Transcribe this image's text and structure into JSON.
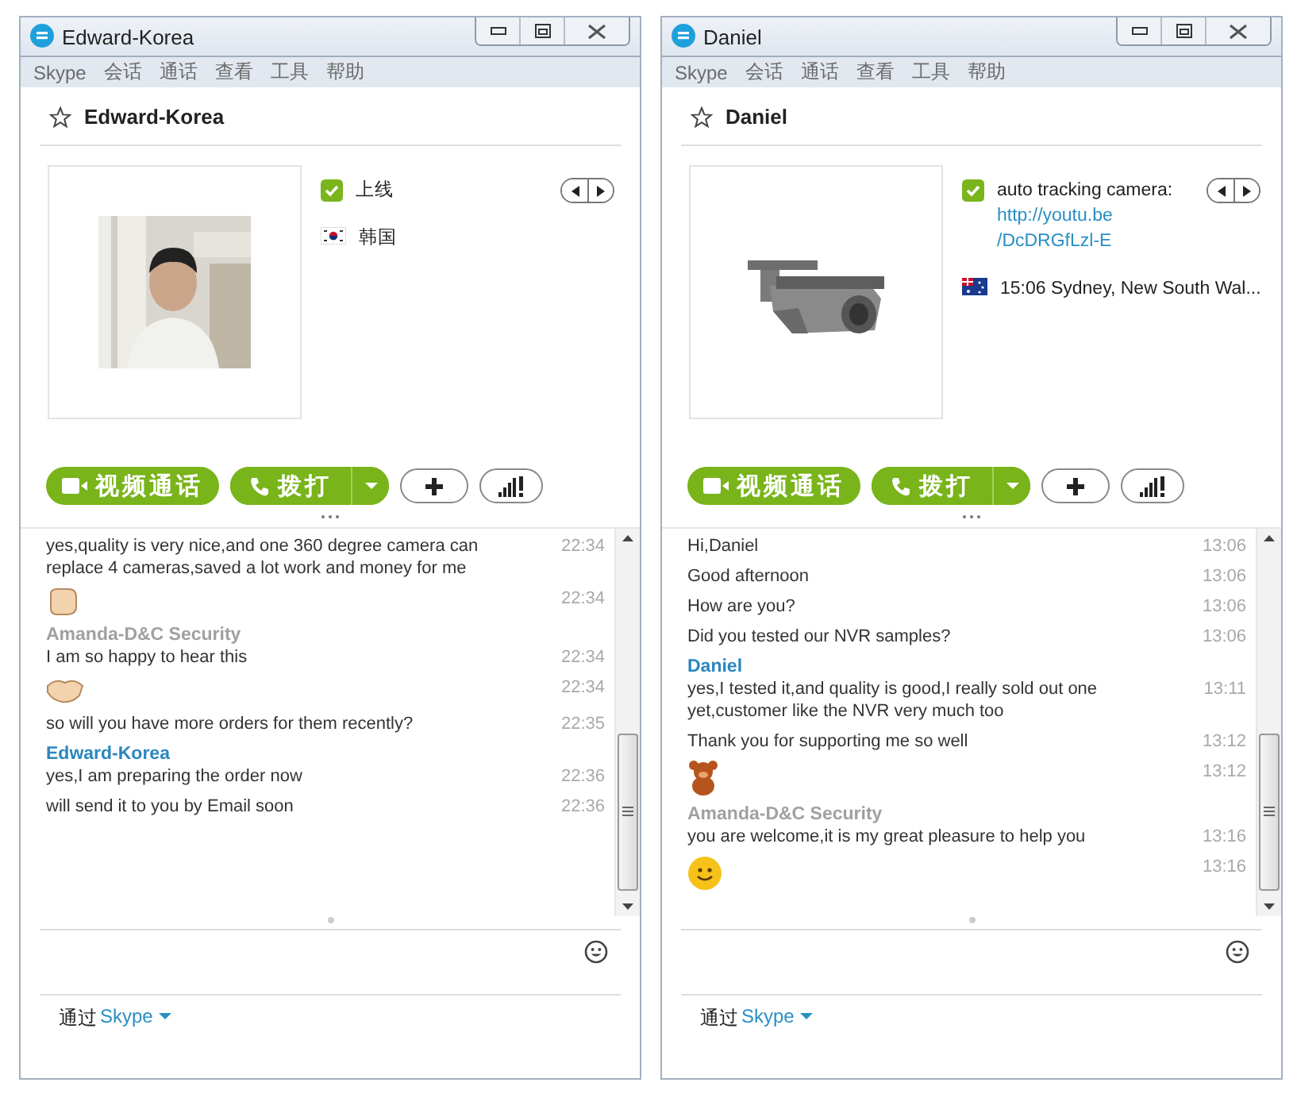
{
  "windows": [
    {
      "title": "Edward-Korea",
      "menu": [
        "Skype",
        "会话",
        "通话",
        "查看",
        "工具",
        "帮助"
      ],
      "contact_name": "Edward-Korea",
      "info": [
        {
          "kind": "status",
          "lines": [
            "上线"
          ]
        },
        {
          "kind": "korea",
          "lines": [
            "韩国"
          ]
        }
      ],
      "buttons": [
        {
          "kind": "video",
          "label": "视频通话"
        },
        {
          "kind": "call",
          "label": "拨打"
        },
        {
          "kind": "add"
        },
        {
          "kind": "signal"
        }
      ],
      "messages": [
        {
          "kind": "text",
          "text": "yes,quality is very nice,and one 360 degree camera can replace 4 cameras,saved a lot work and money for me",
          "time": "22:34"
        },
        {
          "kind": "fist",
          "time": "22:34"
        },
        {
          "kind": "sender",
          "text": "Amanda-D&C Security",
          "color": "#a0a0a0"
        },
        {
          "kind": "text",
          "text": "I am so happy to hear this",
          "time": "22:34"
        },
        {
          "kind": "handshake",
          "time": "22:34"
        },
        {
          "kind": "text",
          "text": "so will you have more orders for them recently?",
          "time": "22:35"
        },
        {
          "kind": "sender",
          "text": "Edward-Korea",
          "color": "#2a86bf"
        },
        {
          "kind": "text",
          "text": "yes,I am preparing the order now",
          "time": "22:36"
        },
        {
          "kind": "text",
          "text": "will send it to you by Email soon",
          "time": "22:36"
        }
      ],
      "footer": {
        "label": "通过",
        "link": "Skype"
      }
    },
    {
      "title": "Daniel",
      "menu": [
        "Skype",
        "会话",
        "通话",
        "查看",
        "工具",
        "帮助"
      ],
      "contact_name": "Daniel",
      "info": [
        {
          "kind": "status",
          "lines": [
            "auto tracking camera:"
          ],
          "link_lines": [
            "http://youtu.be",
            "/DcDRGfLzl-E"
          ]
        },
        {
          "kind": "australia",
          "lines": [
            "15:06 Sydney, New South Wal..."
          ]
        }
      ],
      "buttons": [
        {
          "kind": "video",
          "label": "视频通话"
        },
        {
          "kind": "call",
          "label": "拨打"
        },
        {
          "kind": "add"
        },
        {
          "kind": "signal"
        }
      ],
      "messages": [
        {
          "kind": "text",
          "text": "Hi,Daniel",
          "time": "13:06"
        },
        {
          "kind": "text",
          "text": "Good afternoon",
          "time": "13:06"
        },
        {
          "kind": "text",
          "text": "How are you?",
          "time": "13:06"
        },
        {
          "kind": "text",
          "text": "Did you tested our NVR samples?",
          "time": "13:06"
        },
        {
          "kind": "sender",
          "text": "Daniel",
          "color": "#2a86bf"
        },
        {
          "kind": "text",
          "text": "yes,I tested it,and quality is good,I really sold out one yet,customer like the NVR very much too",
          "time": "13:11"
        },
        {
          "kind": "text",
          "text": "Thank you for supporting me so well",
          "time": "13:12"
        },
        {
          "kind": "bear",
          "time": "13:12"
        },
        {
          "kind": "sender",
          "text": "Amanda-D&C Security",
          "color": "#a0a0a0"
        },
        {
          "kind": "text",
          "text": "you are welcome,it is my great pleasure to help you",
          "time": "13:16"
        },
        {
          "kind": "smile",
          "time": "13:16"
        }
      ],
      "footer": {
        "label": "通过",
        "link": "Skype"
      }
    }
  ]
}
